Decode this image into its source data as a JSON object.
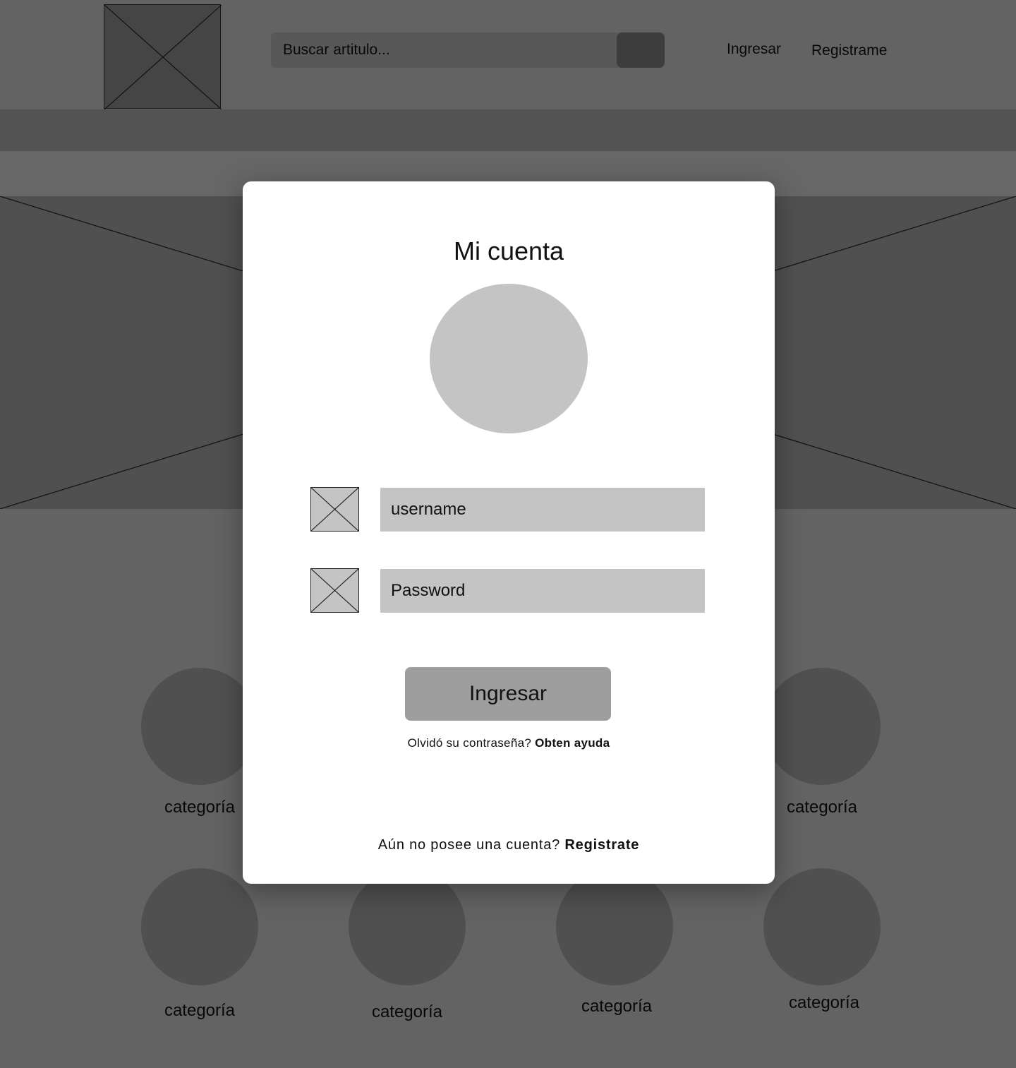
{
  "header": {
    "search": {
      "placeholder": "Buscar artitulo..."
    },
    "nav": {
      "login_label": "Ingresar",
      "register_label": "Registrame"
    }
  },
  "categories": {
    "row1": [
      "categoría",
      "categoría"
    ],
    "row2": [
      "categoría",
      "categoría",
      "categoría",
      "categoría"
    ]
  },
  "modal": {
    "title": "Mi cuenta",
    "username_placeholder": "username",
    "password_placeholder": "Password",
    "submit_label": "Ingresar",
    "forgot_text": "Olvidó su contraseña?",
    "forgot_link": "Obten ayuda",
    "no_account_text": "Aún no posee una cuenta?",
    "register_link": "Registrate"
  },
  "colors": {
    "overlay": "rgba(0,0,0,0.5)",
    "modal_bg": "#ffffff",
    "field_bg": "#c4c4c4",
    "button_bg": "#9e9e9e"
  }
}
